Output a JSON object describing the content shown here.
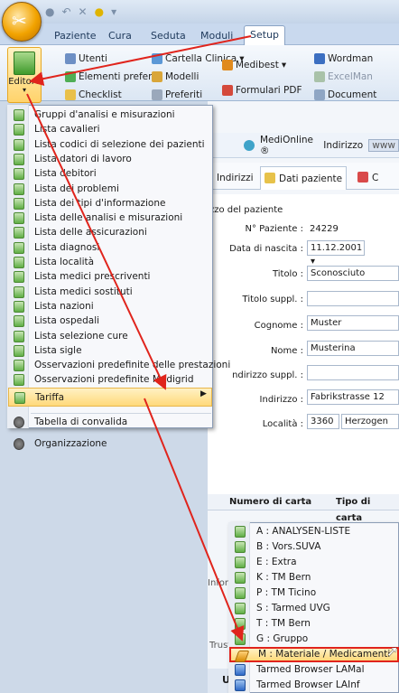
{
  "ribbon": {
    "tabs": [
      "Paziente",
      "Cura",
      "Seduta",
      "Moduli",
      "Setup"
    ],
    "active_tab": "Setup",
    "editore_label": "Editore",
    "items": {
      "utenti": "Utenti",
      "elementi_preferiti": "Elementi preferiti",
      "checklist": "Checklist",
      "cartella_clinica": "Cartella Clinica",
      "modelli": "Modelli",
      "preferiti": "Preferiti",
      "medibest": "Medibest",
      "formulari_pdf": "Formulari PDF",
      "wordman": "Wordman",
      "excelman": "ExcelMan",
      "documenti": "Document"
    }
  },
  "toolbar": {
    "medionline": "MediOnline ®",
    "indirizzo_label": "Indirizzo",
    "indirizzo_value": "www"
  },
  "patient_tabs": [
    "Indirizzi",
    "Dati paziente",
    "C"
  ],
  "patient_form": {
    "section_title": "zzo del paziente",
    "fields": [
      {
        "label": "N° Paziente :",
        "value": "24229"
      },
      {
        "label": "Data di nascita :",
        "value": "11.12.2001 ▾"
      },
      {
        "label": "Titolo :",
        "value": "Sconosciuto"
      },
      {
        "label": "Titolo suppl. :",
        "value": ""
      },
      {
        "label": "Cognome :",
        "value": "Muster"
      },
      {
        "label": "Nome :",
        "value": "Musterina"
      },
      {
        "label": "ndirizzo suppl. :",
        "value": ""
      },
      {
        "label": "Indirizzo :",
        "value": "Fabrikstrasse 12"
      },
      {
        "label": "Località :",
        "value": "3360"
      }
    ],
    "localita_city": "Herzogen"
  },
  "carte": {
    "col1": "Numero di carta",
    "col2": "Tipo di carta"
  },
  "background_labels": {
    "info": "Infor",
    "trust": "Trust",
    "status": "UI"
  },
  "menu": {
    "items": [
      "Gruppi d'analisi e misurazioni",
      "Lista cavalieri",
      "Lista codici di selezione dei pazienti",
      "Lista datori di lavoro",
      "Lista debitori",
      "Lista dei problemi",
      "Lista dei tipi d'informazione",
      "Lista delle analisi e misurazioni",
      "Lista delle assicurazioni",
      "Lista diagnosi",
      "Lista località",
      "Lista medici prescriventi",
      "Lista medici sostituti",
      "Lista nazioni",
      "Lista ospedali",
      "Lista selezione cure",
      "Lista sigle",
      "Osservazioni predefinite delle prestazioni",
      "Osservazioni predefinite Medigrid"
    ],
    "tabella": "Tabella di convalida",
    "tariffa": "Tariffa",
    "organizzazione": "Organizzazione"
  },
  "submenu": {
    "items": [
      "A : ANALYSEN-LISTE",
      "B : Vors.SUVA",
      "E : Extra",
      "K : TM Bern",
      "P : TM Ticino",
      "S : Tarmed UVG",
      "T : TM Bern",
      "G : Gruppo",
      "M : Materiale / Medicamenti",
      "Tarmed Browser LAMal",
      "Tarmed Browser LAInf"
    ]
  },
  "colors": {
    "highlight": "#ffd97a",
    "annotation_red": "#e0241c"
  }
}
